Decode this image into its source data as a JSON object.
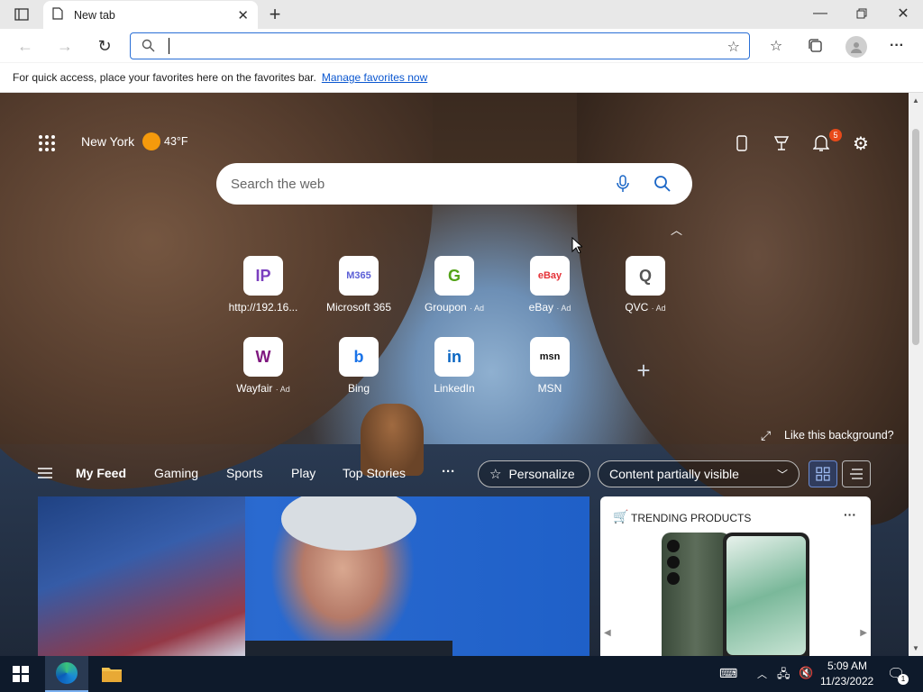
{
  "browser": {
    "tab_title": "New tab",
    "favbar_text": "For quick access, place your favorites here on the favorites bar.",
    "favbar_link": "Manage favorites now",
    "address_value": ""
  },
  "newtab": {
    "location": "New York",
    "temperature": "43°F",
    "notification_count": "5",
    "search_placeholder": "Search the web",
    "quick_links": [
      {
        "label": "http://192.16...",
        "ad": "",
        "icon": "IP",
        "color": "#7b3fbf"
      },
      {
        "label": "Microsoft 365",
        "ad": "",
        "icon": "M365",
        "color": "#5b5fd6"
      },
      {
        "label": "Groupon",
        "ad": "· Ad",
        "icon": "G",
        "color": "#53a318"
      },
      {
        "label": "eBay",
        "ad": "· Ad",
        "icon": "eBay",
        "color": "#e53238"
      },
      {
        "label": "QVC",
        "ad": "· Ad",
        "icon": "Q",
        "color": "#555555"
      },
      {
        "label": "Wayfair",
        "ad": "· Ad",
        "icon": "W",
        "color": "#7f187f"
      },
      {
        "label": "Bing",
        "ad": "",
        "icon": "b",
        "color": "#1a73e8"
      },
      {
        "label": "LinkedIn",
        "ad": "",
        "icon": "in",
        "color": "#0a66c2"
      },
      {
        "label": "MSN",
        "ad": "",
        "icon": "msn",
        "color": "#111111"
      }
    ],
    "like_background": "Like this background?",
    "feed_nav": [
      "My Feed",
      "Gaming",
      "Sports",
      "Play",
      "Top Stories"
    ],
    "personalize": "Personalize",
    "content_visibility": "Content partially visible",
    "trending_title": "TRENDING PRODUCTS"
  },
  "taskbar": {
    "time": "5:09 AM",
    "date": "11/23/2022",
    "notification_badge": "1"
  }
}
